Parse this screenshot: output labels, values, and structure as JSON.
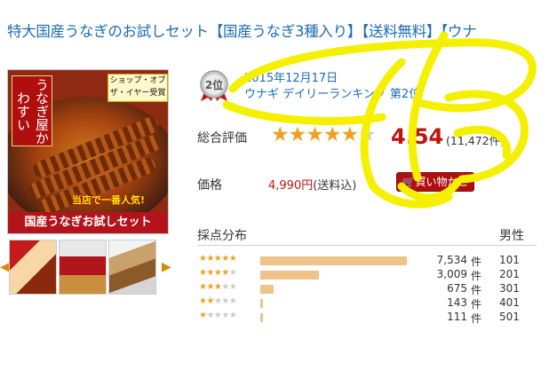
{
  "title": {
    "main": "特大国産うなぎのお試しセット",
    "bracket1": "【国産うなぎ3種入り】",
    "bracket2": "【送料無料】",
    "bracket3": "【ウナ"
  },
  "hero": {
    "logo": "うなぎ屋かわすい",
    "award": "ショップ・オブ ザ・イヤー受賞",
    "tag": "当店で一番人気!",
    "banner": "国産うなぎお試しセット"
  },
  "ranking": {
    "badge": "2位",
    "date": "2015年12月17日",
    "category": "ウナギ",
    "text": "デイリーランキング 第2位"
  },
  "rating": {
    "label": "総合評価",
    "score": "4.54",
    "count": "(11,472件)",
    "stars_filled": 4.54
  },
  "price": {
    "label": "価格",
    "value": "4,990円",
    "note": "(送料込)",
    "buy_label": "買い物かご"
  },
  "distribution": {
    "heading": "採点分布",
    "gender_heading": "男性",
    "rows": [
      {
        "stars": 5,
        "count": "7,534",
        "unit": "件",
        "share": 0.657,
        "age": "101"
      },
      {
        "stars": 4,
        "count": "3,009",
        "unit": "件",
        "share": 0.262,
        "age": "201"
      },
      {
        "stars": 3,
        "count": "675",
        "unit": "件",
        "share": 0.059,
        "age": "301"
      },
      {
        "stars": 2,
        "count": "143",
        "unit": "件",
        "share": 0.012,
        "age": "401"
      },
      {
        "stars": 1,
        "count": "111",
        "unit": "件",
        "share": 0.01,
        "age": "501"
      }
    ]
  },
  "colors": {
    "link": "#1a6db5",
    "accent": "#c0140f",
    "star": "#f0a020",
    "bar": "#eec38a",
    "annotation": "#f4f000"
  }
}
